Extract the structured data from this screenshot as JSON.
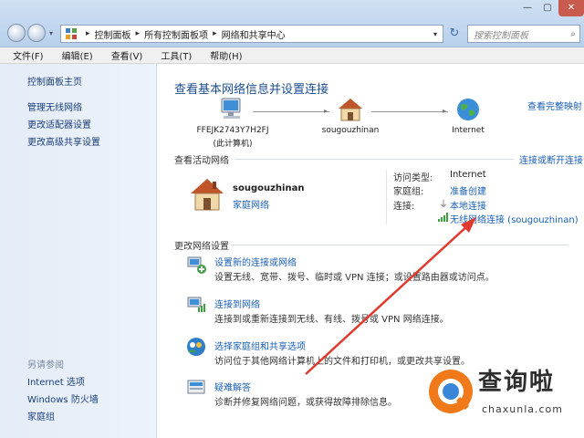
{
  "window": {
    "breadcrumbs": [
      "控制面板",
      "所有控制面板项",
      "网络和共享中心"
    ],
    "search_placeholder": "搜索控制面板"
  },
  "menu": [
    "文件(F)",
    "编辑(E)",
    "查看(V)",
    "工具(T)",
    "帮助(H)"
  ],
  "sidebar": {
    "items": [
      "控制面板主页",
      "管理无线网络",
      "更改适配器设置",
      "更改高级共享设置"
    ],
    "see_also_title": "另请参阅",
    "see_also": [
      "Internet 选项",
      "Windows 防火墙",
      "家庭组"
    ]
  },
  "main": {
    "title": "查看基本网络信息并设置连接",
    "full_map": "查看完整映射",
    "nodes": [
      {
        "label": "FFEJK2743Y7H2FJ",
        "sublabel": "(此计算机)"
      },
      {
        "label": "sougouzhinan"
      },
      {
        "label": "Internet"
      }
    ],
    "active_title": "查看活动网络",
    "connect_link": "连接或断开连接",
    "network": {
      "name": "sougouzhinan",
      "type": "家庭网络",
      "access_type_label": "访问类型:",
      "access_type_value": "Internet",
      "homegroup_label": "家庭组:",
      "homegroup_value": "准备创建",
      "connections_label": "连接:",
      "connection_1": "本地连接",
      "connection_2": "无线网络连接 (sougouzhinan)"
    },
    "change_title": "更改网络设置",
    "tasks": [
      {
        "title": "设置新的连接或网络",
        "desc": "设置无线、宽带、拨号、临时或 VPN 连接；或设置路由器或访问点。"
      },
      {
        "title": "连接到网络",
        "desc": "连接到或重新连接到无线、有线、拨号或 VPN 网络连接。"
      },
      {
        "title": "选择家庭组和共享选项",
        "desc": "访问位于其他网络计算机上的文件和打印机，或更改共享设置。"
      },
      {
        "title": "疑难解答",
        "desc": "诊断并修复网络问题，或获得故障排除信息。"
      }
    ]
  },
  "watermark": {
    "text": "查询啦",
    "url": "chaxunla.com"
  },
  "colors": {
    "link": "#1a5fb4",
    "title": "#1e4d8f",
    "arrow": "#e03a2e"
  }
}
